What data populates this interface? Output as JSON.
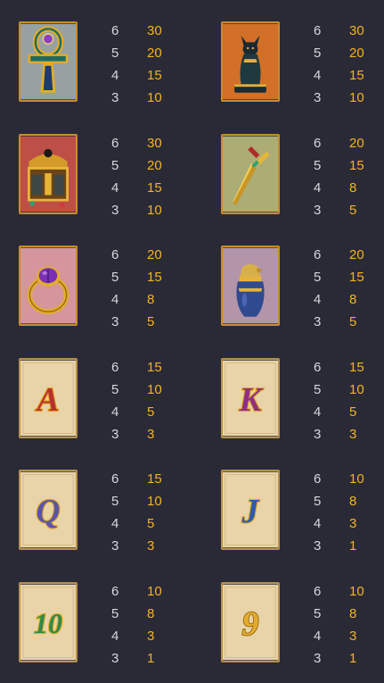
{
  "symbols": [
    {
      "icon": "ankh-icon",
      "pays": [
        {
          "count": "6",
          "value": "30"
        },
        {
          "count": "5",
          "value": "20"
        },
        {
          "count": "4",
          "value": "15"
        },
        {
          "count": "3",
          "value": "10"
        }
      ]
    },
    {
      "icon": "cat-statue-icon",
      "pays": [
        {
          "count": "6",
          "value": "30"
        },
        {
          "count": "5",
          "value": "20"
        },
        {
          "count": "4",
          "value": "15"
        },
        {
          "count": "3",
          "value": "10"
        }
      ]
    },
    {
      "icon": "treasure-chest-icon",
      "pays": [
        {
          "count": "6",
          "value": "30"
        },
        {
          "count": "5",
          "value": "20"
        },
        {
          "count": "4",
          "value": "15"
        },
        {
          "count": "3",
          "value": "10"
        }
      ]
    },
    {
      "icon": "dagger-icon",
      "pays": [
        {
          "count": "6",
          "value": "20"
        },
        {
          "count": "5",
          "value": "15"
        },
        {
          "count": "4",
          "value": "8"
        },
        {
          "count": "3",
          "value": "5"
        }
      ]
    },
    {
      "icon": "scarab-ring-icon",
      "pays": [
        {
          "count": "6",
          "value": "20"
        },
        {
          "count": "5",
          "value": "15"
        },
        {
          "count": "4",
          "value": "8"
        },
        {
          "count": "3",
          "value": "5"
        }
      ]
    },
    {
      "icon": "canopic-jar-icon",
      "pays": [
        {
          "count": "6",
          "value": "20"
        },
        {
          "count": "5",
          "value": "15"
        },
        {
          "count": "4",
          "value": "8"
        },
        {
          "count": "3",
          "value": "5"
        }
      ]
    },
    {
      "icon": "letter-a-icon",
      "glyph": "A",
      "pays": [
        {
          "count": "6",
          "value": "15"
        },
        {
          "count": "5",
          "value": "10"
        },
        {
          "count": "4",
          "value": "5"
        },
        {
          "count": "3",
          "value": "3"
        }
      ]
    },
    {
      "icon": "letter-k-icon",
      "glyph": "K",
      "pays": [
        {
          "count": "6",
          "value": "15"
        },
        {
          "count": "5",
          "value": "10"
        },
        {
          "count": "4",
          "value": "5"
        },
        {
          "count": "3",
          "value": "3"
        }
      ]
    },
    {
      "icon": "letter-q-icon",
      "glyph": "Q",
      "pays": [
        {
          "count": "6",
          "value": "15"
        },
        {
          "count": "5",
          "value": "10"
        },
        {
          "count": "4",
          "value": "5"
        },
        {
          "count": "3",
          "value": "3"
        }
      ]
    },
    {
      "icon": "letter-j-icon",
      "glyph": "J",
      "pays": [
        {
          "count": "6",
          "value": "10"
        },
        {
          "count": "5",
          "value": "8"
        },
        {
          "count": "4",
          "value": "3"
        },
        {
          "count": "3",
          "value": "1"
        }
      ]
    },
    {
      "icon": "number-10-icon",
      "glyph": "10",
      "pays": [
        {
          "count": "6",
          "value": "10"
        },
        {
          "count": "5",
          "value": "8"
        },
        {
          "count": "4",
          "value": "3"
        },
        {
          "count": "3",
          "value": "1"
        }
      ]
    },
    {
      "icon": "number-9-icon",
      "glyph": "9",
      "pays": [
        {
          "count": "6",
          "value": "10"
        },
        {
          "count": "5",
          "value": "8"
        },
        {
          "count": "4",
          "value": "3"
        },
        {
          "count": "3",
          "value": "1"
        }
      ]
    }
  ],
  "colors": {
    "background": "#2a2a37",
    "count_text": "#d6d6dc",
    "value_text": "#f4b321",
    "frame": "#c98d2c"
  }
}
